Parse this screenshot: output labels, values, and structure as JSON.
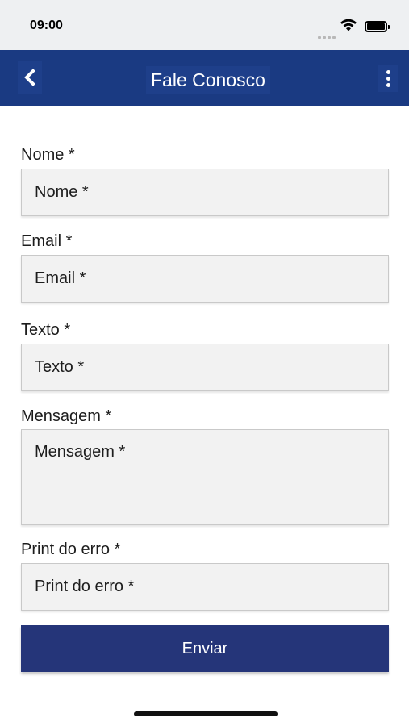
{
  "status_bar": {
    "time": "09:00"
  },
  "header": {
    "title": "Fale Conosco",
    "back_icon": "chevron-left-icon",
    "menu_icon": "more-vertical-icon",
    "background_color": "#1a3a82"
  },
  "form": {
    "fields": [
      {
        "label": "Nome *",
        "placeholder": "Nome *",
        "value": ""
      },
      {
        "label": "Email *",
        "placeholder": "Email *",
        "value": ""
      },
      {
        "label": "Texto *",
        "placeholder": "Texto *",
        "value": ""
      },
      {
        "label": "Mensagem *",
        "placeholder": "Mensagem *",
        "value": ""
      },
      {
        "label": "Print do erro *",
        "placeholder": "Print do erro *",
        "value": ""
      }
    ],
    "submit_label": "Enviar",
    "submit_color": "#253579"
  }
}
